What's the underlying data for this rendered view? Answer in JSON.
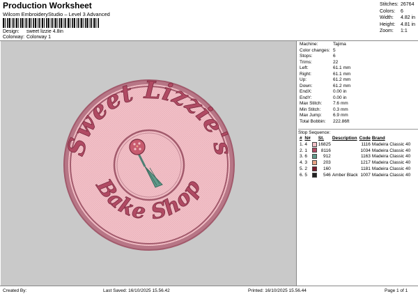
{
  "header": {
    "title": "Production Worksheet",
    "subtitle": "Wilcom EmbroideryStudio – Level 3 Advanced",
    "design_label": "Design:",
    "design_value": "sweet lizzie 4.8in",
    "colorway_label": "Colorway:",
    "colorway_value": "Colorway 1"
  },
  "stats": [
    {
      "label": "Stitches:",
      "value": "26764"
    },
    {
      "label": "Colors:",
      "value": "6"
    },
    {
      "label": "Width:",
      "value": "4.82 in"
    },
    {
      "label": "Height:",
      "value": "4.81 in"
    },
    {
      "label": "Zoom:",
      "value": "1:1"
    }
  ],
  "info": [
    {
      "label": "Machine:",
      "value": "Tajima"
    },
    {
      "label": "Color changes:",
      "value": "5"
    },
    {
      "label": "Stops:",
      "value": "6"
    },
    {
      "label": "Trims:",
      "value": "22"
    },
    {
      "label": "Left:",
      "value": "61.1 mm"
    },
    {
      "label": "Right:",
      "value": "61.1 mm"
    },
    {
      "label": "Up:",
      "value": "61.2 mm"
    },
    {
      "label": "Down:",
      "value": "61.2 mm"
    },
    {
      "label": "EndX:",
      "value": "0.00 in"
    },
    {
      "label": "EndY:",
      "value": "0.00 in"
    },
    {
      "label": "Max Stitch:",
      "value": "7.6 mm"
    },
    {
      "label": "Min Stitch:",
      "value": "0.3 mm"
    },
    {
      "label": "Max Jump:",
      "value": "6.9 mm"
    },
    {
      "label": "Total Bobbin:",
      "value": "222.86ft"
    }
  ],
  "stop_sequence": {
    "title": "Stop Sequence:",
    "columns": [
      "#",
      "N#",
      "St.",
      "Description",
      "Code",
      "Brand"
    ],
    "rows": [
      {
        "num": "1.",
        "n": "4",
        "color": "#f2c1c8",
        "st": "16825",
        "desc": "",
        "code": "1116",
        "brand": "Madeira Classic 40"
      },
      {
        "num": "2.",
        "n": "1",
        "color": "#b04a63",
        "st": "8116",
        "desc": "",
        "code": "1034",
        "brand": "Madeira Classic 40"
      },
      {
        "num": "3.",
        "n": "6",
        "color": "#5f9a8a",
        "st": "912",
        "desc": "",
        "code": "1163",
        "brand": "Madeira Classic 40"
      },
      {
        "num": "4.",
        "n": "3",
        "color": "#e8a385",
        "st": "203",
        "desc": "",
        "code": "1217",
        "brand": "Madeira Classic 40"
      },
      {
        "num": "5.",
        "n": "2",
        "color": "#7a1c2e",
        "st": "160",
        "desc": "",
        "code": "1181",
        "brand": "Madeira Classic 40"
      },
      {
        "num": "6.",
        "n": "5",
        "color": "#222222",
        "st": "546",
        "desc": "Amber Black",
        "code": "1007",
        "brand": "Madeira Classic 40"
      }
    ]
  },
  "design": {
    "top_text": "Sweet Lizzie's",
    "bottom_text": "Bake Shop",
    "fill_color": "#f2c1c8",
    "text_color": "#b04a63",
    "border_color": "#a25a6c",
    "handle_color": "#5f9a8a"
  },
  "footer": {
    "created_by": "Created By:",
    "last_saved": "Last Saved: 16/10/2025 15.56.42",
    "printed": "Printed: 16/10/2025 15.56.44",
    "page": "Page 1 of 1"
  }
}
